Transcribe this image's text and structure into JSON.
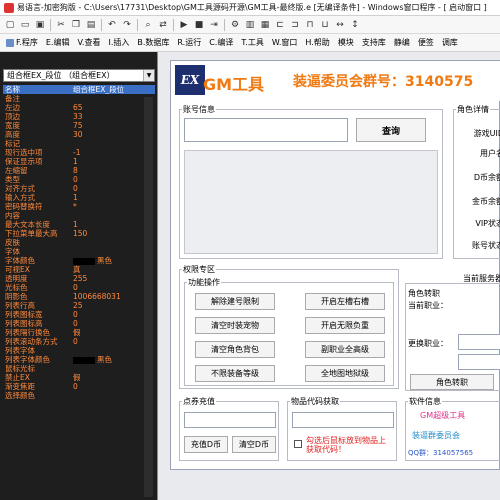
{
  "window": {
    "title": "易语言-加密狗版 - C:\\Users\\17731\\Desktop\\GM工具源码开源\\GM工具-最终版.e [无编译条件] - Windows窗口程序 - [ 启动窗口 ]"
  },
  "menu": [
    {
      "label": "F.程序"
    },
    {
      "label": "E.编辑"
    },
    {
      "label": "V.查看"
    },
    {
      "label": "I.插入"
    },
    {
      "label": "B.数据库"
    },
    {
      "label": "R.运行"
    },
    {
      "label": "C.编译"
    },
    {
      "label": "T.工具"
    },
    {
      "label": "W.窗口"
    },
    {
      "label": "H.帮助"
    },
    {
      "label": "模块"
    },
    {
      "label": "支持库"
    },
    {
      "label": "静编"
    },
    {
      "label": "便签"
    },
    {
      "label": "调库"
    }
  ],
  "component_selector": {
    "value": "组合框EX_段位 （组合框EX）"
  },
  "properties": [
    {
      "name": "名称",
      "value": "组合框EX_段位",
      "selected": true
    },
    {
      "name": "备注",
      "value": ""
    },
    {
      "name": "左边",
      "value": "65"
    },
    {
      "name": "顶边",
      "value": "33"
    },
    {
      "name": "宽度",
      "value": "75"
    },
    {
      "name": "高度",
      "value": "30"
    },
    {
      "name": "标记",
      "value": ""
    },
    {
      "name": "现行选中项",
      "value": "-1"
    },
    {
      "name": "保证显示项",
      "value": "1"
    },
    {
      "name": "左缩留",
      "value": "8"
    },
    {
      "name": "类型",
      "value": "0"
    },
    {
      "name": "对齐方式",
      "value": "0"
    },
    {
      "name": "输入方式",
      "value": "1"
    },
    {
      "name": "密码替换符",
      "value": "*"
    },
    {
      "name": "内容",
      "value": ""
    },
    {
      "name": "最大文本长度",
      "value": "1"
    },
    {
      "name": "下拉菜单最大高",
      "value": "150"
    },
    {
      "name": "皮肤",
      "value": ""
    },
    {
      "name": "字体",
      "value": ""
    },
    {
      "name": "字体颜色",
      "value": "黑色",
      "swatch": "#000000"
    },
    {
      "name": "可视EX",
      "value": "真"
    },
    {
      "name": "透明度",
      "value": "255"
    },
    {
      "name": "光标色",
      "value": "0"
    },
    {
      "name": "阴影色",
      "value": "1006668031"
    },
    {
      "name": "列表行高",
      "value": "25"
    },
    {
      "name": "列表图标宽",
      "value": "0"
    },
    {
      "name": "列表图标高",
      "value": "0"
    },
    {
      "name": "列表隔行换色",
      "value": "假"
    },
    {
      "name": "列表滚动条方式",
      "value": "0"
    },
    {
      "name": "列表字体",
      "value": ""
    },
    {
      "name": "列表字体颜色",
      "value": "黑色",
      "swatch": "#000000"
    },
    {
      "name": "鼠标光标",
      "value": ""
    },
    {
      "name": "禁止EX",
      "value": "假"
    },
    {
      "name": "渐变焦距",
      "value": "0"
    },
    {
      "name": "选择颜色",
      "value": ""
    }
  ],
  "form": {
    "logo_text": "EX",
    "app_title": "GM工具",
    "qq_group": "装逼委员会群号：3140575",
    "account": {
      "group_label": "账号信息",
      "query_button": "查询"
    },
    "role_detail": {
      "group_label": "角色详情",
      "fields": [
        {
          "label": "游戏UID："
        },
        {
          "label": "用户名："
        },
        {
          "label": "D币余额："
        },
        {
          "label": "金币余额："
        },
        {
          "label": "VIP状态："
        },
        {
          "label": "账号状态："
        }
      ]
    },
    "privilege": {
      "group_label": "权限专区",
      "func_label": "功能操作",
      "buttons": [
        {
          "label": "解除建号限制"
        },
        {
          "label": "开启左槽右槽"
        },
        {
          "label": "清空时装宠物"
        },
        {
          "label": "开启无限负重"
        },
        {
          "label": "清空角色背包"
        },
        {
          "label": "副职业全高级"
        },
        {
          "label": "不限装备等级"
        },
        {
          "label": "全地图地狱级"
        }
      ]
    },
    "server": {
      "current_label": "当前服务器",
      "role_transfer_label": "角色转职",
      "current_job_label": "当前职业：",
      "change_job_label": "更换职业：",
      "transfer_button": "角色转职"
    },
    "coupon": {
      "group_label": "点券充值",
      "recharge_button": "充值D币",
      "clear_button": "清空D币"
    },
    "item_code": {
      "group_label": "物品代码获取",
      "checkbox_text": "勾选后鼠标放到物品上获取代码！"
    },
    "software": {
      "group_label": "软件信息",
      "line1": "GM超级工具",
      "line2": "装逼群委员会",
      "line3": "QQ群：314057565"
    }
  }
}
